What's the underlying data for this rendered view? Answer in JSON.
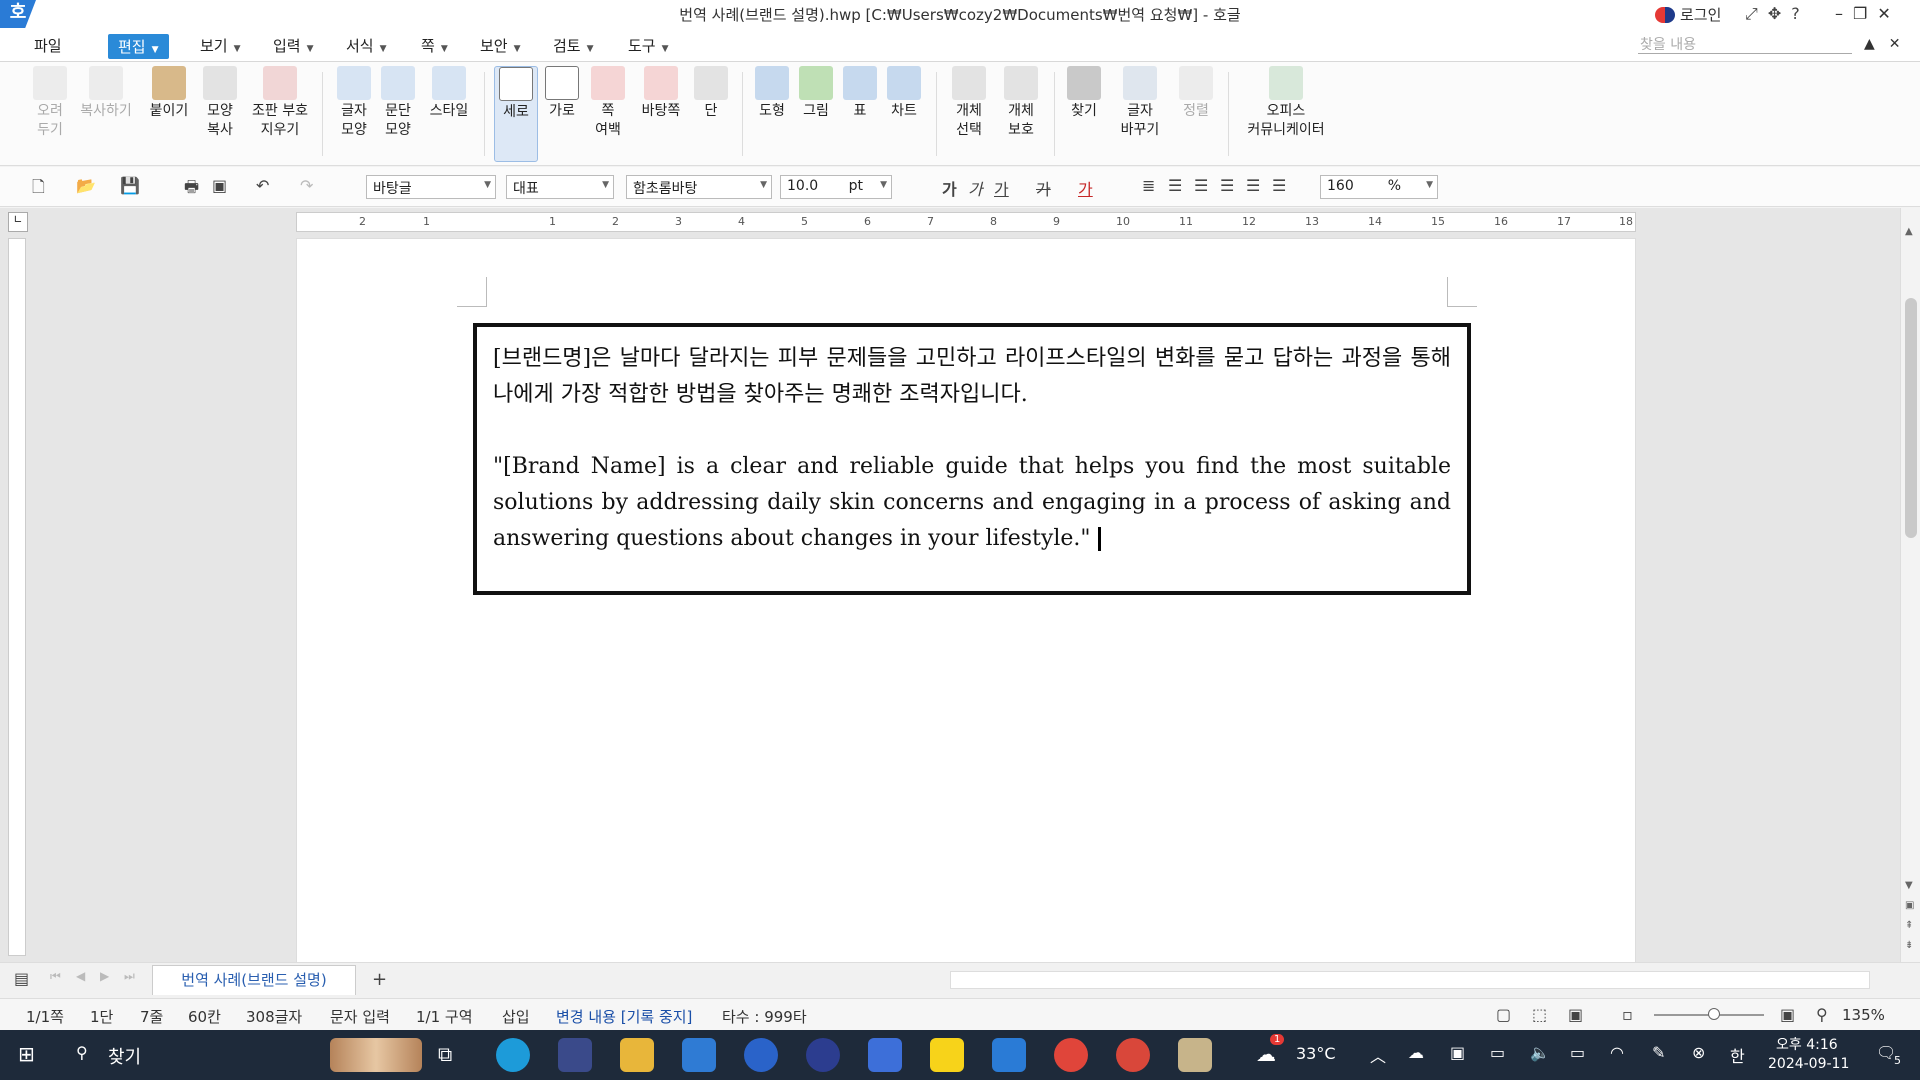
{
  "window": {
    "logo": "호",
    "title": "번역 사례(브랜드 설명).hwp [C:₩Users₩cozy2₩Documents₩번역 요청₩] - 호글",
    "login": "로그인"
  },
  "menu": {
    "items": [
      "파일",
      "편집",
      "보기",
      "입력",
      "서식",
      "쪽",
      "보안",
      "검토",
      "도구"
    ],
    "active": "편집",
    "search_placeholder": "찾을 내용"
  },
  "ribbon": {
    "cut": "오려\n두기",
    "copy": "복사하기",
    "paste": "붙이기",
    "format_copy": "모양\n복사",
    "clear_marks": "조판 부호\n지우기",
    "char_shape": "글자\n모양",
    "para_shape": "문단\n모양",
    "style": "스타일",
    "portrait": "세로",
    "landscape": "가로",
    "margins": "쪽\n여백",
    "background": "바탕쪽",
    "columns": "단",
    "shapes": "도형",
    "picture": "그림",
    "table": "표",
    "chart": "차트",
    "select_obj": "개체\n선택",
    "protect_obj": "개체\n보호",
    "find": "찾기",
    "replace": "글자\n바꾸기",
    "sort": "정렬",
    "office_comm": "오피스\n커뮤니케이터"
  },
  "format": {
    "style": "바탕글",
    "lang": "대표",
    "font": "함초롬바탕",
    "size": "10.0",
    "size_unit": "pt",
    "zoom": "160",
    "zoom_unit": "%"
  },
  "ruler": {
    "marks": [
      "2",
      "1",
      "1",
      "2",
      "3",
      "4",
      "5",
      "6",
      "7",
      "8",
      "9",
      "10",
      "11",
      "12",
      "13",
      "14",
      "15",
      "16",
      "17",
      "18"
    ]
  },
  "document": {
    "paragraph_ko": "[브랜드명]은 날마다 달라지는 피부 문제들을 고민하고 라이프스타일의 변화를 묻고 답하는 과정을 통해 나에게 가장 적합한 방법을 찾아주는 명쾌한 조력자입니다.",
    "paragraph_en": "\"[Brand Name] is a clear and reliable guide that helps you find the most suitable solutions by addressing daily skin concerns and engaging in a process of asking and answering questions about changes in your lifestyle.\""
  },
  "tabs": {
    "doc_tab": "번역 사례(브랜드 설명)",
    "add": "+"
  },
  "status": {
    "page": "1/1쪽",
    "column": "1단",
    "line": "7줄",
    "col_pos": "60칸",
    "chars": "308글자",
    "input_mode": "문자 입력",
    "section": "1/1 구역",
    "insert": "삽입",
    "track": "변경 내용 [기록 중지]",
    "typing": "타수 : 999타",
    "zoom": "135%"
  },
  "taskbar": {
    "search": "찾기",
    "weather": "33°C",
    "weather_badge": "1",
    "ime": "한",
    "time": "오후 4:16",
    "date": "2024-09-11",
    "notify": "5"
  },
  "colors": {
    "accent": "#2a8ad8",
    "taskbar": "#1e2a3a"
  }
}
